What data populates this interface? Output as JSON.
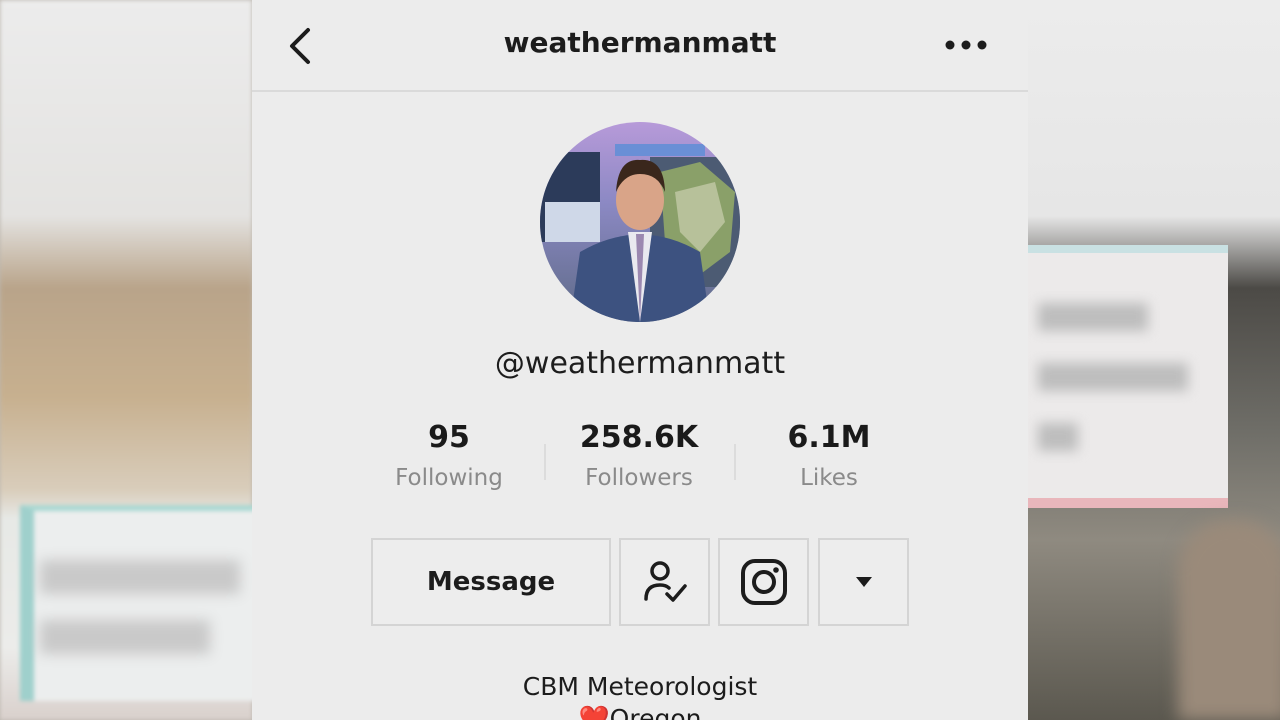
{
  "header": {
    "title": "weathermanmatt",
    "back_icon": "chevron-left-icon",
    "more_icon": "more-horizontal-icon"
  },
  "profile": {
    "handle": "@weathermanmatt",
    "avatar_icon": "profile-photo"
  },
  "stats": [
    {
      "value": "95",
      "label": "Following"
    },
    {
      "value": "258.6K",
      "label": "Followers"
    },
    {
      "value": "6.1M",
      "label": "Likes"
    }
  ],
  "actions": {
    "message_label": "Message",
    "follow_icon": "user-check-icon",
    "instagram_icon": "instagram-icon",
    "dropdown_icon": "caret-down-icon"
  },
  "bio": {
    "line1": "CBM Meteorologist",
    "line2": "❤️Oregon"
  }
}
